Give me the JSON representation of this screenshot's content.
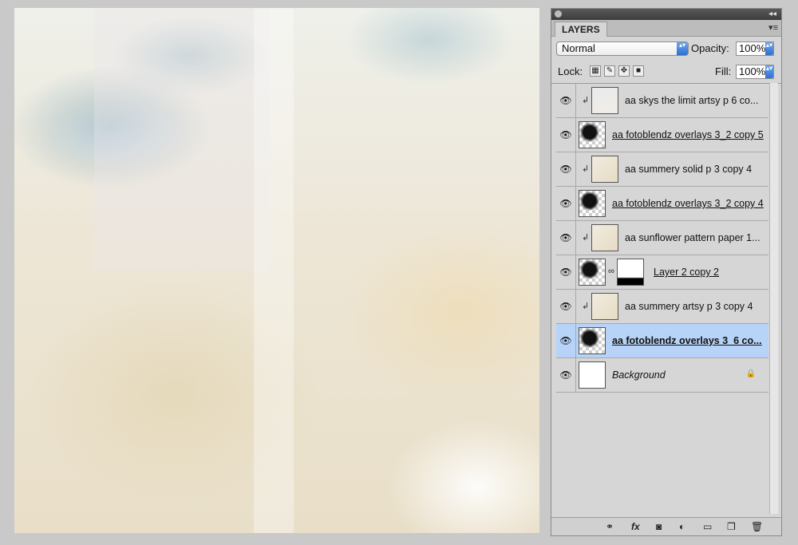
{
  "panel": {
    "tab_label": "LAYERS",
    "menu_icon": "panel-menu-icon",
    "blend_mode": "Normal",
    "opacity_label": "Opacity:",
    "opacity_value": "100%",
    "lock_label": "Lock:",
    "fill_label": "Fill:",
    "fill_value": "100%"
  },
  "layers": [
    {
      "name": "aa skys the limit artsy p 6 co...",
      "clipped": true,
      "thumb": "sky",
      "visible": true
    },
    {
      "name": "aa fotoblendz overlays 3_2 copy 5",
      "clipped": false,
      "thumb": "overlay",
      "visible": true
    },
    {
      "name": "aa summery solid p 3 copy 4",
      "clipped": true,
      "thumb": "paper",
      "visible": true
    },
    {
      "name": "aa fotoblendz overlays 3_2 copy 4",
      "clipped": false,
      "thumb": "overlay",
      "visible": true
    },
    {
      "name": "aa sunflower pattern paper 1...",
      "clipped": true,
      "thumb": "paper",
      "visible": true
    },
    {
      "name": "Layer 2 copy 2",
      "clipped": false,
      "thumb": "overlay",
      "mask": true,
      "visible": true
    },
    {
      "name": "aa summery artsy p 3 copy 4",
      "clipped": true,
      "thumb": "paper",
      "visible": true
    },
    {
      "name": "aa fotoblendz overlays 3_6 co...",
      "clipped": false,
      "thumb": "overlay",
      "selected": true,
      "visible": true
    },
    {
      "name": "Background",
      "clipped": false,
      "thumb": "white",
      "locked": true,
      "visible": true
    }
  ],
  "bottom_icons": [
    "link-layers-icon",
    "fx-icon",
    "add-mask-icon",
    "adjustment-layer-icon",
    "new-group-icon",
    "new-layer-icon",
    "delete-layer-icon"
  ],
  "glyphs": {
    "eye": "👁",
    "clip": "↲",
    "chain": "∞",
    "lock": "🔒",
    "fx": "fx",
    "mask": "◙",
    "adjust": "◐",
    "folder": "▭",
    "newlayer": "❐",
    "trash": "🗑",
    "link": "⚭",
    "collapse": "◂◂",
    "menu": "▾≡",
    "spin": "▴▾"
  }
}
